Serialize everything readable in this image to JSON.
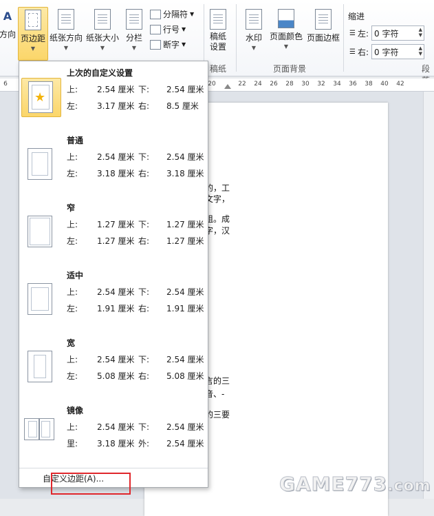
{
  "ribbon": {
    "direction_label": "方向",
    "margins_label": "页边距",
    "orientation_label": "纸张方向",
    "size_label": "纸张大小",
    "columns_label": "分栏",
    "breaks_label": "分隔符",
    "line_numbers_label": "行号",
    "hyphenation_label": "断字",
    "draft_label": "稿纸设置",
    "draft_group": "稿纸",
    "watermark_label": "水印",
    "page_color_label": "页面颜色",
    "page_border_label": "页面边框",
    "page_bg_group": "页面背景",
    "indent_title": "缩进",
    "indent_left_label": "左:",
    "indent_left_value": "0 字符",
    "indent_right_label": "右:",
    "indent_right_value": "0 字符",
    "paragraph_group": "段落"
  },
  "ruler": {
    "ticks": [
      "6",
      "20",
      "22",
      "24",
      "26",
      "28",
      "30",
      "32",
      "34",
      "36",
      "38",
      "40",
      "42"
    ]
  },
  "document": {
    "fragments": [
      "的，工",
      "文字，",
      "组。成",
      "字，汉",
      "言的三",
      "音、-",
      "的三要"
    ]
  },
  "margins_menu": {
    "options": [
      {
        "title": "上次的自定义设置",
        "r1": [
          "上:",
          "2.54 厘米",
          "下:",
          "2.54 厘米"
        ],
        "r2": [
          "左:",
          "3.17 厘米",
          "右:",
          "8.5 厘米"
        ]
      },
      {
        "title": "普通",
        "r1": [
          "上:",
          "2.54 厘米",
          "下:",
          "2.54 厘米"
        ],
        "r2": [
          "左:",
          "3.18 厘米",
          "右:",
          "3.18 厘米"
        ]
      },
      {
        "title": "窄",
        "r1": [
          "上:",
          "1.27 厘米",
          "下:",
          "1.27 厘米"
        ],
        "r2": [
          "左:",
          "1.27 厘米",
          "右:",
          "1.27 厘米"
        ]
      },
      {
        "title": "适中",
        "r1": [
          "上:",
          "2.54 厘米",
          "下:",
          "2.54 厘米"
        ],
        "r2": [
          "左:",
          "1.91 厘米",
          "右:",
          "1.91 厘米"
        ]
      },
      {
        "title": "宽",
        "r1": [
          "上:",
          "2.54 厘米",
          "下:",
          "2.54 厘米"
        ],
        "r2": [
          "左:",
          "5.08 厘米",
          "右:",
          "5.08 厘米"
        ]
      },
      {
        "title": "镜像",
        "r1": [
          "上:",
          "2.54 厘米",
          "下:",
          "2.54 厘米"
        ],
        "r2": [
          "里:",
          "3.18 厘米",
          "外:",
          "2.54 厘米"
        ]
      }
    ],
    "custom_label": "自定义边距(A)..."
  },
  "watermark": {
    "main": "GAME773",
    "suffix": ".com"
  }
}
